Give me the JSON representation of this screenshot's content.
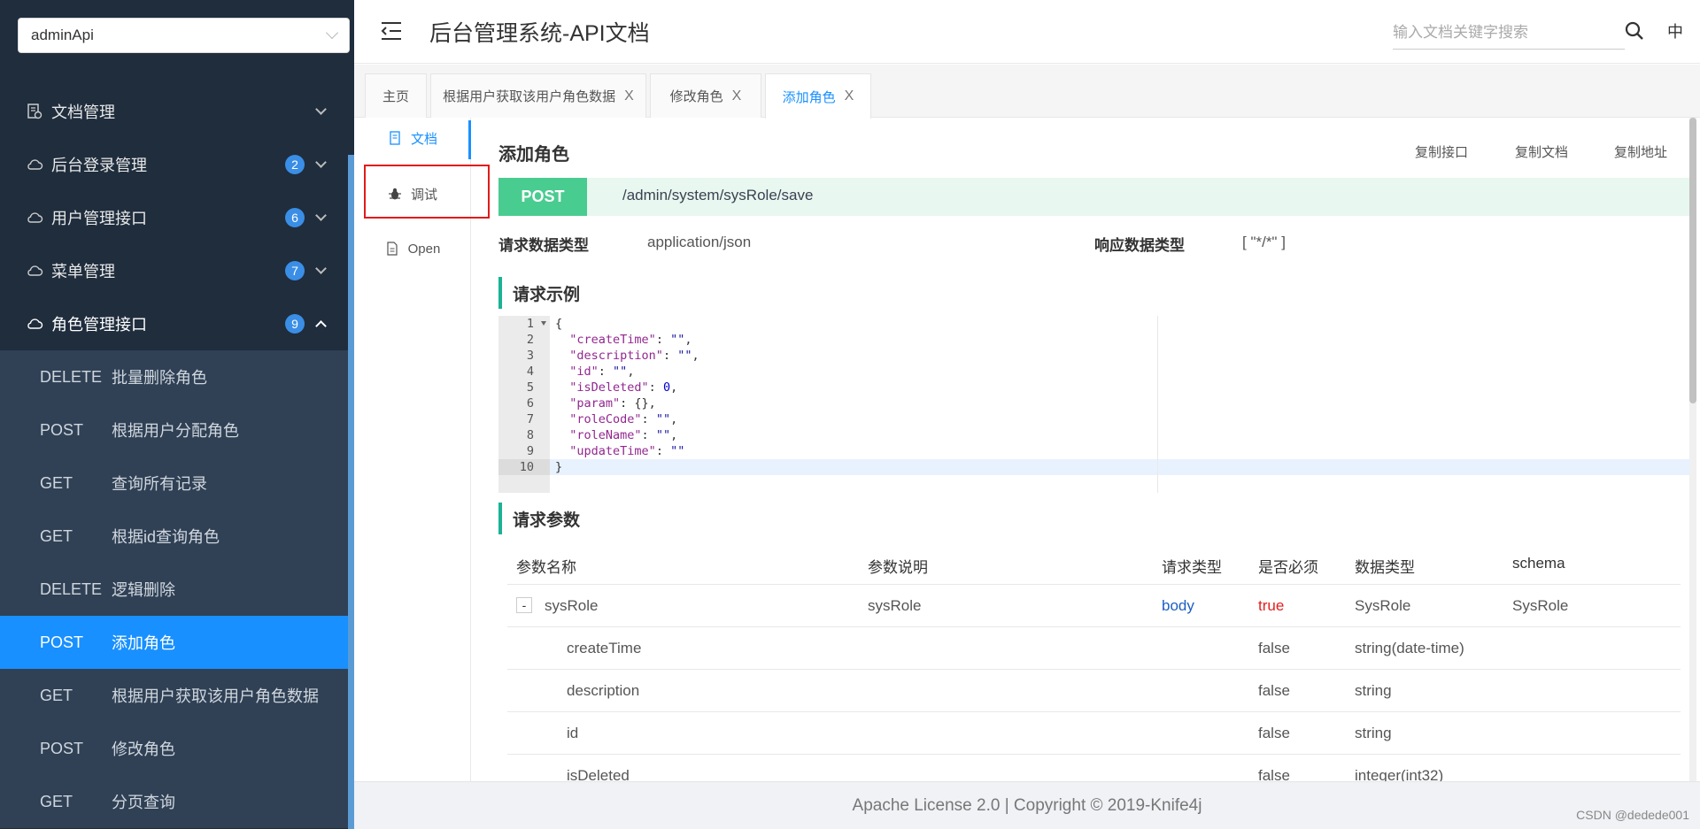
{
  "sidebar": {
    "group_select": "adminApi",
    "groups": [
      {
        "label": "文档管理",
        "badge": ""
      },
      {
        "label": "后台登录管理",
        "badge": "2"
      },
      {
        "label": "用户管理接口",
        "badge": "6"
      },
      {
        "label": "菜单管理",
        "badge": "7"
      },
      {
        "label": "角色管理接口",
        "badge": "9"
      }
    ],
    "sub_items": [
      {
        "method": "DELETE",
        "label": "批量删除角色"
      },
      {
        "method": "POST",
        "label": "根据用户分配角色"
      },
      {
        "method": "GET",
        "label": "查询所有记录"
      },
      {
        "method": "GET",
        "label": "根据id查询角色"
      },
      {
        "method": "DELETE",
        "label": "逻辑删除"
      },
      {
        "method": "POST",
        "label": "添加角色"
      },
      {
        "method": "GET",
        "label": "根据用户获取该用户角色数据"
      },
      {
        "method": "POST",
        "label": "修改角色"
      },
      {
        "method": "GET",
        "label": "分页查询"
      }
    ]
  },
  "header": {
    "title": "后台管理系统-API文档",
    "search_placeholder": "输入文档关键字搜索",
    "lang": "中"
  },
  "tabs": [
    {
      "label": "主页"
    },
    {
      "label": "根据用户获取该用户角色数据"
    },
    {
      "label": "修改角色"
    },
    {
      "label": "添加角色"
    }
  ],
  "tab_close_glyph": "X",
  "sidenav": [
    {
      "label": "文档"
    },
    {
      "label": "调试"
    },
    {
      "label": "Open"
    }
  ],
  "api": {
    "title": "添加角色",
    "copy_api": "复制接口",
    "copy_doc": "复制文档",
    "copy_addr": "复制地址",
    "method": "POST",
    "path": "/admin/system/sysRole/save",
    "req_type_label": "请求数据类型",
    "req_type_value": "application/json",
    "resp_type_label": "响应数据类型",
    "resp_type_value": "[ \"*/*\" ]"
  },
  "example": {
    "title": "请求示例",
    "lines": [
      "{",
      "  \"createTime\": \"\",",
      "  \"description\": \"\",",
      "  \"id\": \"\",",
      "  \"isDeleted\": 0,",
      "  \"param\": {},",
      "  \"roleCode\": \"\",",
      "  \"roleName\": \"\",",
      "  \"updateTime\": \"\"",
      "}"
    ]
  },
  "params": {
    "title": "请求参数",
    "headers": [
      "参数名称",
      "参数说明",
      "请求类型",
      "是否必须",
      "数据类型",
      "schema"
    ],
    "rows": [
      {
        "name": "sysRole",
        "desc": "sysRole",
        "in": "body",
        "required": "true",
        "type": "SysRole",
        "schema": "SysRole"
      },
      {
        "name": "createTime",
        "desc": "",
        "in": "",
        "required": "false",
        "type": "string(date-time)",
        "schema": ""
      },
      {
        "name": "description",
        "desc": "",
        "in": "",
        "required": "false",
        "type": "string",
        "schema": ""
      },
      {
        "name": "id",
        "desc": "",
        "in": "",
        "required": "false",
        "type": "string",
        "schema": ""
      },
      {
        "name": "isDeleted",
        "desc": "",
        "in": "",
        "required": "false",
        "type": "integer(int32)",
        "schema": ""
      }
    ],
    "collapse_glyph": "-"
  },
  "footer": {
    "license": "Apache License 2.0 | Copyright © 2019-Knife4j",
    "watermark": "CSDN @dedede001"
  },
  "colors": {
    "sidebar_bg": "#1f2d3d",
    "active_item": "#1890ff",
    "post_badge": "#49cc90",
    "section_accent": "#1ab394",
    "highlight_box": "#e21a1a"
  }
}
